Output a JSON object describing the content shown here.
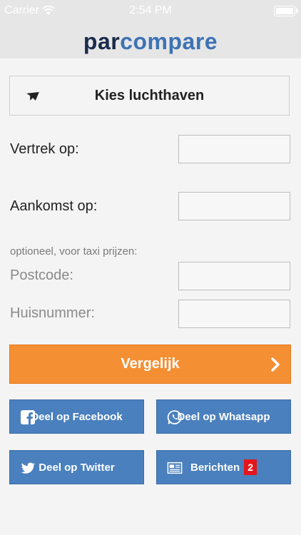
{
  "status_bar": {
    "carrier": "Carrier",
    "time": "2:54 PM"
  },
  "header": {
    "logo_part1": "par",
    "logo_part2": "compare"
  },
  "airport": {
    "label": "Kies luchthaven"
  },
  "form": {
    "departure_label": "Vertrek op:",
    "departure_value": "",
    "arrival_label": "Aankomst op:",
    "arrival_value": "",
    "optional_hint": "optioneel, voor taxi prijzen:",
    "postcode_label": "Postcode:",
    "postcode_value": "",
    "housenumber_label": "Huisnummer:",
    "housenumber_value": ""
  },
  "compare_button": {
    "label": "Vergelijk"
  },
  "share": {
    "facebook_label": "Deel op Facebook",
    "whatsapp_label": "Deel op Whatsapp",
    "twitter_label": "Deel op Twitter",
    "messages_label": "Berichten",
    "messages_count": "2"
  },
  "colors": {
    "orange": "#f58f33",
    "blue": "#4a80be",
    "logo_dark": "#1b2b4b",
    "logo_blue": "#3d73b4",
    "badge_red": "#e4151b"
  }
}
